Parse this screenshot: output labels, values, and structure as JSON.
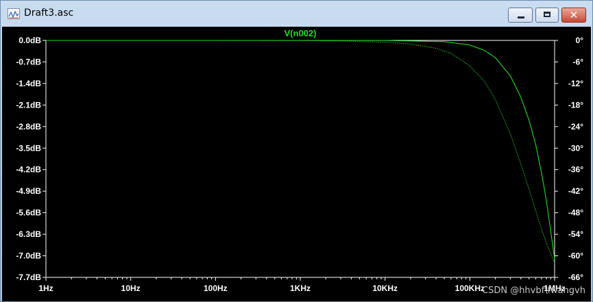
{
  "window": {
    "title": "Draft3.asc",
    "buttons": {
      "minimize": "minimize",
      "maximize": "maximize",
      "close": "✕"
    }
  },
  "icons": [
    "waveform-icon",
    "minimize-icon",
    "maximize-icon",
    "close-icon"
  ],
  "colors": {
    "trace": "#22dd22",
    "axis_text": "#ffffff",
    "background": "#000000",
    "frame": "#ffffff"
  },
  "watermark": "CSDN @hhvbf\\fwangvh",
  "chart_data": {
    "type": "line",
    "title": "V(n002)",
    "x_scale": "log",
    "xlim": [
      1,
      1000000
    ],
    "x_ticks": [
      "1Hz",
      "10Hz",
      "100Hz",
      "1KHz",
      "10KHz",
      "100KHz",
      "1MHz"
    ],
    "y_left_unit": "dB",
    "ylim_left": [
      -7.7,
      0.0
    ],
    "y_left_ticks": [
      "0.0dB",
      "-0.7dB",
      "-1.4dB",
      "-2.1dB",
      "-2.8dB",
      "-3.5dB",
      "-4.2dB",
      "-4.9dB",
      "-5.6dB",
      "-6.3dB",
      "-7.0dB",
      "-7.7dB"
    ],
    "y_right_unit": "degrees",
    "ylim_right": [
      -66,
      0
    ],
    "y_right_ticks": [
      "0°",
      "-6°",
      "-12°",
      "-18°",
      "-24°",
      "-30°",
      "-36°",
      "-42°",
      "-48°",
      "-54°",
      "-60°",
      "-66°"
    ],
    "grid": false,
    "series": [
      {
        "name": "V(n002)",
        "quantity": "magnitude (dB)",
        "axis": "left",
        "style": "solid",
        "x": [
          1,
          10,
          100,
          1000,
          10000,
          50000,
          100000,
          150000,
          200000,
          300000,
          400000,
          500000,
          600000,
          700000,
          800000,
          900000,
          1000000
        ],
        "y": [
          0,
          0,
          0,
          0,
          -0.002,
          -0.04,
          -0.15,
          -0.33,
          -0.56,
          -1.15,
          -1.85,
          -2.6,
          -3.4,
          -4.3,
          -5.2,
          -6.2,
          -7.1
        ]
      },
      {
        "name": "V(n002)",
        "quantity": "phase (degrees)",
        "axis": "right",
        "style": "dotted",
        "x": [
          1,
          10,
          100,
          1000,
          3000,
          10000,
          20000,
          40000,
          60000,
          100000,
          150000,
          200000,
          300000,
          400000,
          500000,
          600000,
          700000,
          800000,
          1000000
        ],
        "y": [
          0,
          0,
          0,
          -0.05,
          -0.15,
          -0.5,
          -1.0,
          -2.2,
          -3.6,
          -7.1,
          -11.5,
          -16.5,
          -26,
          -34.5,
          -41.5,
          -47.5,
          -52.5,
          -56.5,
          -62
        ]
      }
    ]
  }
}
